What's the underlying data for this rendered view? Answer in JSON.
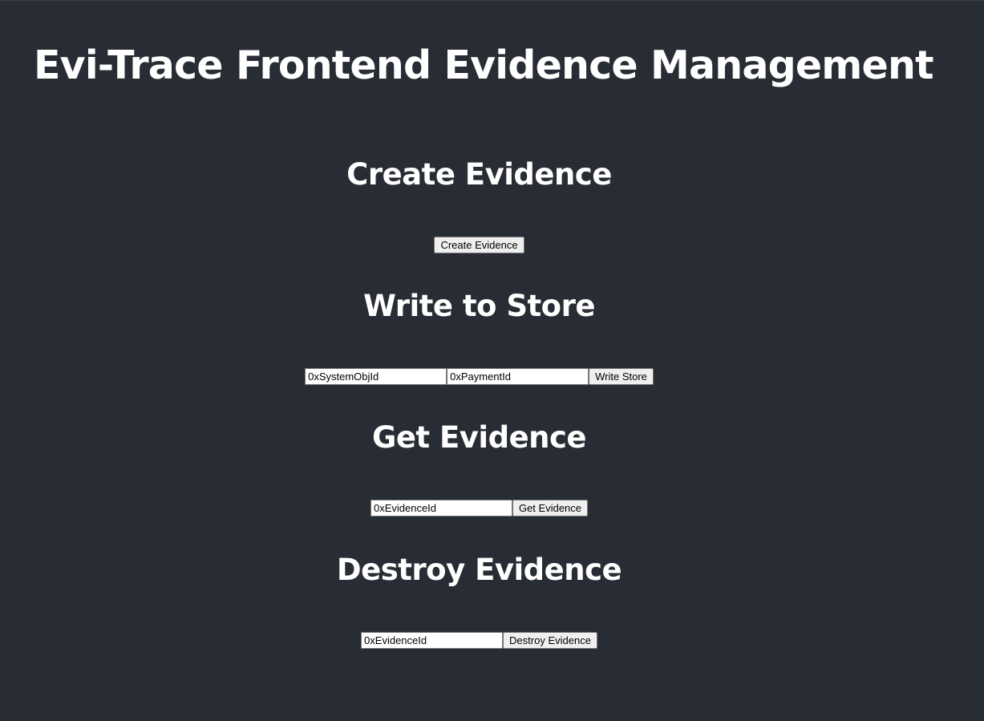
{
  "header": {
    "title": "Evi-Trace Frontend Evidence Management"
  },
  "create": {
    "heading": "Create Evidence",
    "button_label": "Create Evidence"
  },
  "write": {
    "heading": "Write to Store",
    "system_obj_placeholder": "0xSystemObjId",
    "payment_placeholder": "0xPaymentId",
    "button_label": "Write Store"
  },
  "get": {
    "heading": "Get Evidence",
    "evidence_placeholder": "0xEvidenceId",
    "button_label": "Get Evidence"
  },
  "destroy": {
    "heading": "Destroy Evidence",
    "evidence_placeholder": "0xEvidenceId",
    "button_label": "Destroy Evidence"
  },
  "colors": {
    "background": "#282c34",
    "text": "#ffffff",
    "button_bg": "#efefef",
    "input_bg": "#ffffff"
  }
}
